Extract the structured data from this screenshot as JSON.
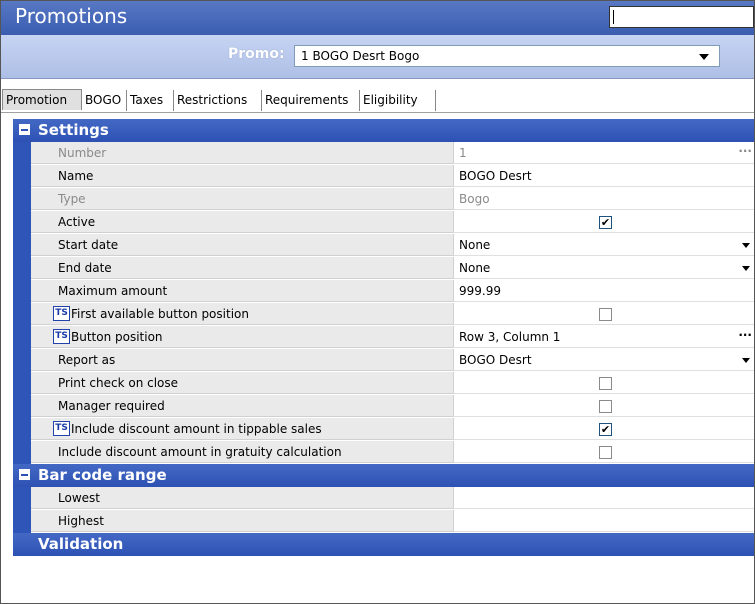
{
  "window": {
    "title": "Promotions",
    "search_value": ""
  },
  "promo": {
    "label": "Promo:",
    "value": "1 BOGO Desrt Bogo"
  },
  "tabs": [
    "Promotion",
    "BOGO",
    "Taxes",
    "Restrictions",
    "Requirements",
    "Eligibility"
  ],
  "sections": {
    "settings": "Settings",
    "barcode": "Bar code range",
    "validation": "Validation"
  },
  "settings": [
    {
      "label": "Number",
      "value": "1"
    },
    {
      "label": "Name",
      "value": "BOGO Desrt"
    },
    {
      "label": "Type",
      "value": "Bogo"
    },
    {
      "label": "Active",
      "checked": true
    },
    {
      "label": "Start date",
      "value": "None"
    },
    {
      "label": "End date",
      "value": "None"
    },
    {
      "label": "Maximum amount",
      "value": "999.99"
    },
    {
      "label": "First available button position",
      "checked": false,
      "icon": "ts-icon"
    },
    {
      "label": "Button position",
      "value": "Row 3, Column 1",
      "icon": "ts-icon"
    },
    {
      "label": "Report as",
      "value": "BOGO Desrt"
    },
    {
      "label": "Print check on close",
      "checked": false
    },
    {
      "label": "Manager required",
      "checked": false
    },
    {
      "label": "Include discount amount in tippable sales",
      "checked": true,
      "icon": "ts-icon"
    },
    {
      "label": "Include discount amount in gratuity calculation",
      "checked": false
    }
  ],
  "barcode": [
    {
      "label": "Lowest",
      "value": ""
    },
    {
      "label": "Highest",
      "value": ""
    }
  ],
  "icons": {
    "ts_glyph": "TS",
    "check_glyph": "✔",
    "ellipsis": "···"
  },
  "colors": {
    "header_blue": "#3a5db0",
    "section_blue": "#2d52b4"
  }
}
